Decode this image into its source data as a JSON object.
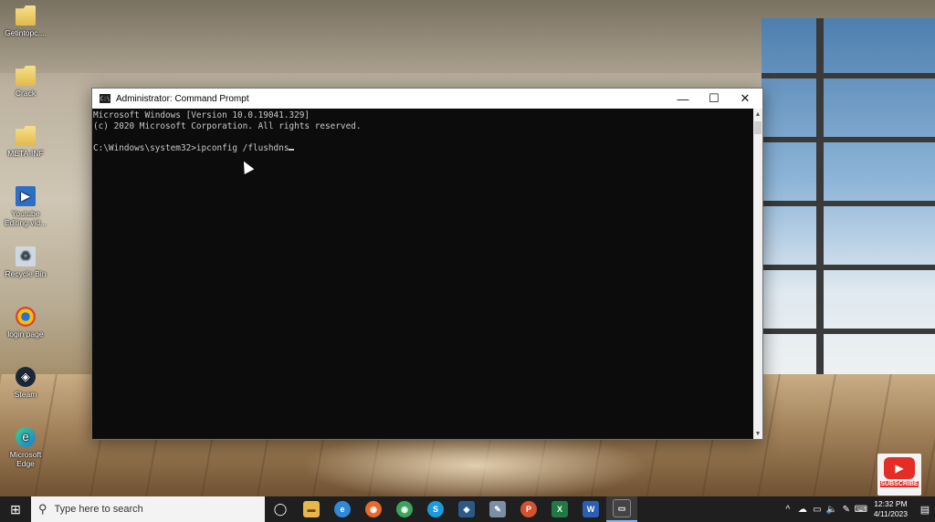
{
  "desktop_icons": [
    {
      "label": "Getintopc....",
      "icon": "folder-icon"
    },
    {
      "label": "Crack",
      "icon": "folder-icon"
    },
    {
      "label": "META-INF",
      "icon": "folder-icon"
    },
    {
      "label": "Youtube Editing vid...",
      "icon": "video-file-icon"
    },
    {
      "label": "Recycle Bin",
      "icon": "recycle-bin-icon"
    },
    {
      "label": "login page",
      "icon": "chrome-icon"
    },
    {
      "label": "Steam",
      "icon": "steam-icon"
    },
    {
      "label": "Microsoft Edge",
      "icon": "edge-icon"
    }
  ],
  "cmd": {
    "title": "Administrator: Command Prompt",
    "lines": [
      "Microsoft Windows [Version 10.0.19041.329]",
      "(c) 2020 Microsoft Corporation. All rights reserved.",
      "",
      "C:\\Windows\\system32>ipconfig /flushdns"
    ],
    "buttons": {
      "minimize": "—",
      "maximize": "☐",
      "close": "✕"
    }
  },
  "subscribe": {
    "label": "SUBSCRIBE"
  },
  "taskbar": {
    "search_placeholder": "Type here to search",
    "apps": [
      {
        "name": "task-view",
        "glyph": "◯",
        "color": "transparent"
      },
      {
        "name": "file-explorer",
        "glyph": "▬",
        "color": "#e8b64a"
      },
      {
        "name": "edge",
        "glyph": "e",
        "color": "#2f89d8"
      },
      {
        "name": "firefox",
        "glyph": "◉",
        "color": "#e66a2a"
      },
      {
        "name": "chrome",
        "glyph": "◉",
        "color": "#3ba55c"
      },
      {
        "name": "skype",
        "glyph": "S",
        "color": "#1a9bdc"
      },
      {
        "name": "steam",
        "glyph": "◈",
        "color": "#2b5a86"
      },
      {
        "name": "notes",
        "glyph": "✎",
        "color": "#7c8fa6"
      },
      {
        "name": "powerpoint",
        "glyph": "P",
        "color": "#d35230"
      },
      {
        "name": "excel",
        "glyph": "X",
        "color": "#1f7a45"
      },
      {
        "name": "word",
        "glyph": "W",
        "color": "#2b5fb4"
      },
      {
        "name": "command-prompt",
        "glyph": "▭",
        "color": "#444444"
      }
    ],
    "tray": [
      "^",
      "☁",
      "▭",
      "🔈",
      "✎",
      "⌨"
    ],
    "time": "12:32 PM",
    "date": "4/11/2023"
  }
}
